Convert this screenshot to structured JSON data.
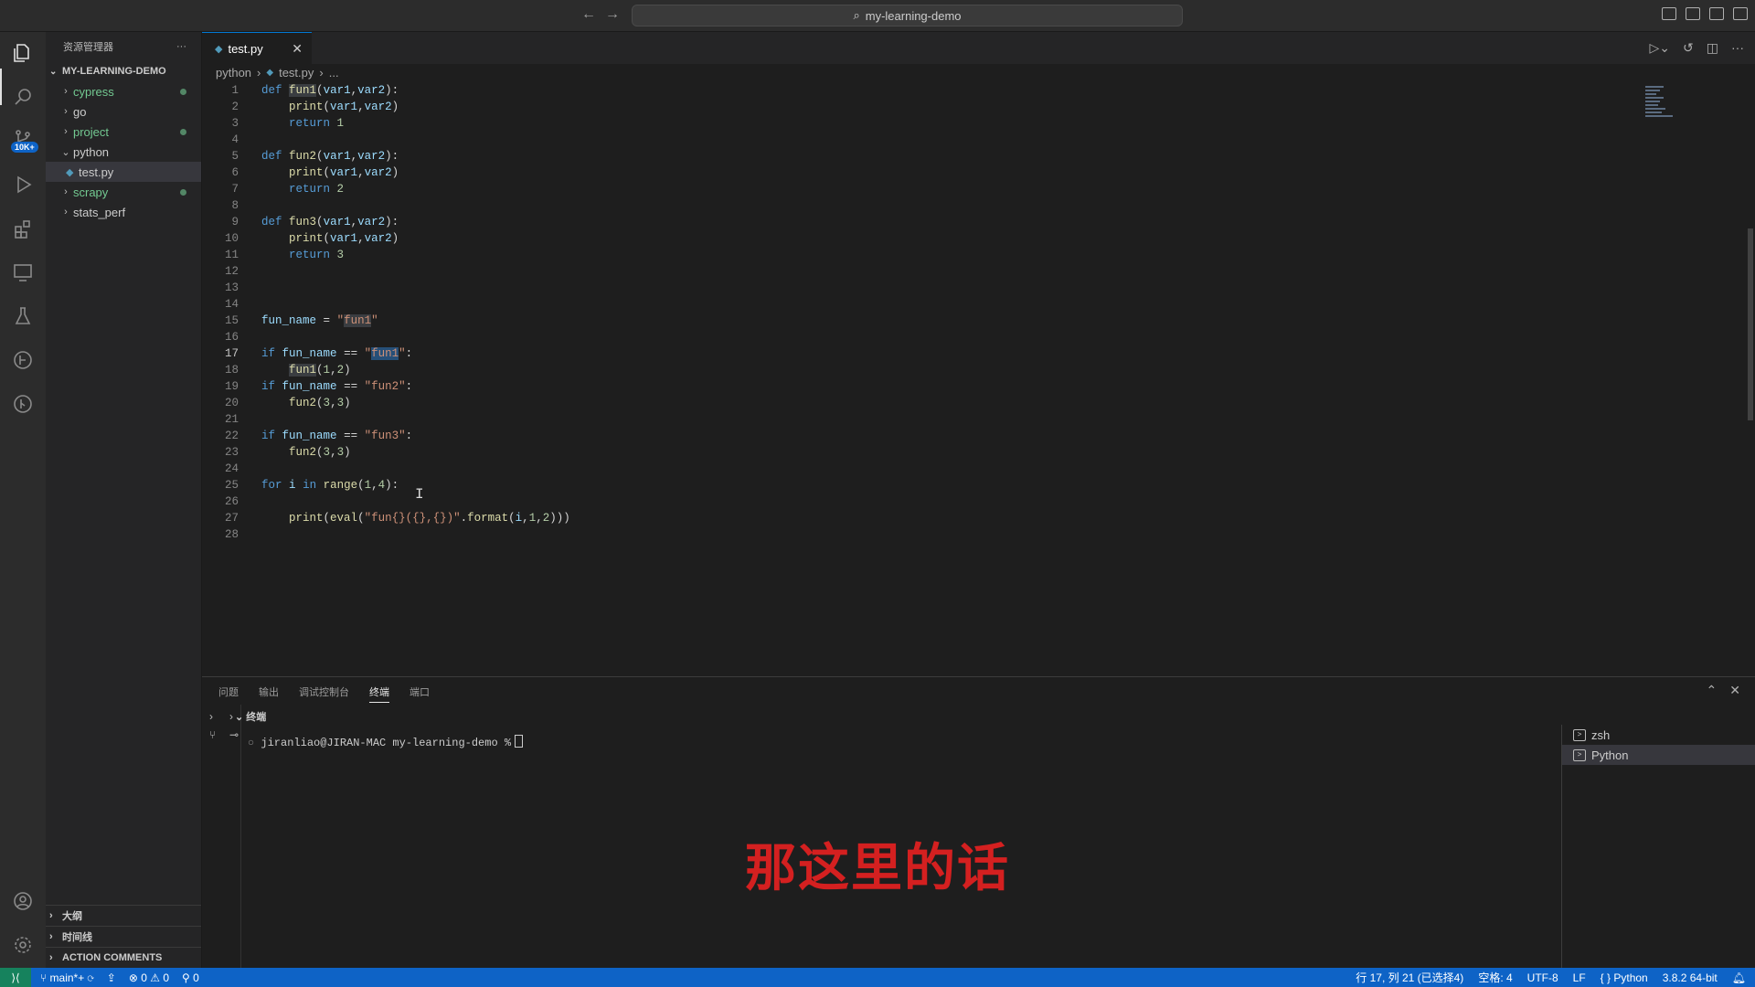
{
  "titlebar": {
    "search": "my-learning-demo"
  },
  "activity": {
    "badge": "10K+"
  },
  "sidebar": {
    "title": "资源管理器",
    "more": "···",
    "root": "MY-LEARNING-DEMO",
    "items": [
      {
        "label": "cypress",
        "expanded": false,
        "modified": true
      },
      {
        "label": "go",
        "expanded": false,
        "modified": false
      },
      {
        "label": "project",
        "expanded": false,
        "modified": true
      },
      {
        "label": "python",
        "expanded": true,
        "modified": false
      },
      {
        "label": "test.py",
        "selected": true
      },
      {
        "label": "scrapy",
        "expanded": false,
        "modified": true
      },
      {
        "label": "stats_perf",
        "expanded": false,
        "modified": false
      }
    ],
    "sections": [
      "大纲",
      "时间线",
      "ACTION COMMENTS"
    ]
  },
  "editor": {
    "tab": "test.py",
    "breadcrumb": [
      "python",
      "test.py",
      "..."
    ],
    "current_line": 17
  },
  "panel": {
    "tabs": [
      "问题",
      "输出",
      "调试控制台",
      "终端",
      "端口"
    ],
    "active_tab": "终端",
    "terminal_header": "终端",
    "prompt": "jiranliao@JIRAN-MAC my-learning-demo %",
    "terminals": [
      "zsh",
      "Python"
    ]
  },
  "subtitle": "那这里的话",
  "statusbar": {
    "branch": "main*+",
    "errors": "0",
    "warnings": "0",
    "ports": "0",
    "position": "行 17, 列 21 (已选择4)",
    "spaces": "空格: 4",
    "encoding": "UTF-8",
    "eol": "LF",
    "language": "Python",
    "interpreter": "3.8.2 64-bit"
  }
}
